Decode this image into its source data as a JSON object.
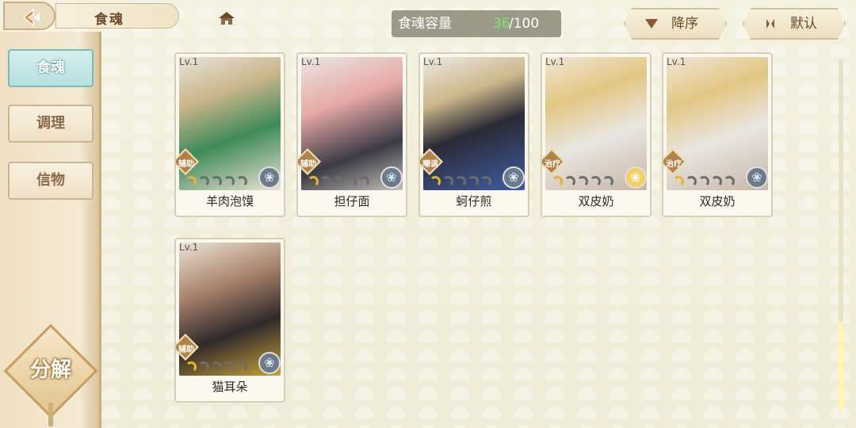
{
  "header": {
    "title": "食魂",
    "capacity": {
      "label": "食魂容量",
      "current": "36",
      "total": "/100"
    },
    "sort_order_label": "降序",
    "sort_default_label": "默认"
  },
  "sidebar": {
    "tabs": [
      {
        "label": "食魂",
        "active": true
      },
      {
        "label": "调理",
        "active": false
      },
      {
        "label": "信物",
        "active": false
      }
    ],
    "decompose_label": "分解"
  },
  "cards": [
    {
      "level": "Lv.1",
      "role": "辅助",
      "name": "羊肉泡馍",
      "element": "dark-flower"
    },
    {
      "level": "Lv.1",
      "role": "辅助",
      "name": "担仔面",
      "element": "dark-flower"
    },
    {
      "level": "Lv.1",
      "role": "嘲讽",
      "name": "蚵仔煎",
      "element": "dark-flower"
    },
    {
      "level": "Lv.1",
      "role": "治疗",
      "name": "双皮奶",
      "element": "gold-flower"
    },
    {
      "level": "Lv.1",
      "role": "治疗",
      "name": "双皮奶",
      "element": "dark-flower"
    },
    {
      "level": "Lv.1",
      "role": "辅助",
      "name": "猫耳朵",
      "element": "dark-flower"
    }
  ],
  "colors": {
    "background": "#f1efdd",
    "capacity_current": "#7fe36d",
    "active_tab": "#b6e0e0",
    "accent_gold": "#e6b52a"
  }
}
